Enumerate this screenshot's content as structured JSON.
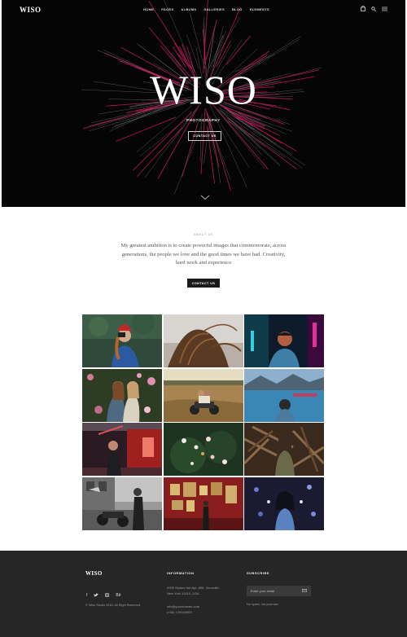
{
  "header": {
    "logo": "WISO",
    "menu": [
      "HOME",
      "PAGES",
      "ALBUMS",
      "GALLERIES",
      "BLOG",
      "ELEMENTS"
    ],
    "icons": [
      "bag-icon",
      "search-icon",
      "menu-icon"
    ]
  },
  "hero": {
    "title": "WISO",
    "subtitle": "PHOTOGRAPHY",
    "button_label": "CONTACT US"
  },
  "about": {
    "label": "ABOUT US",
    "text": "My greatest ambition is to create powerful images that commemorate, across generations, the people we love and the good times we have had. Creativity, hard work and experience",
    "button_label": "CONTACT US"
  },
  "gallery": {
    "tiles": [
      "woman-camera-red-beanie",
      "hair-closeup",
      "man-neon-lights",
      "women-flowers",
      "couple-motorcycle-field",
      "lake-mountains",
      "woman-red-neon-door",
      "flowers-dark",
      "woman-wood-pile",
      "motorcycle-street-bw",
      "red-gallery-room",
      "woman-blue-flowers"
    ]
  },
  "footer": {
    "logo": "WISO",
    "social": [
      "facebook-icon",
      "twitter-icon",
      "instagram-icon",
      "behance-icon"
    ],
    "copyright": "© Wiso Studio 2018. All Right Reserved.",
    "information_heading": "INFORMATION",
    "address_line1": "2005 Stokes Isle Apt. 896, Venaville,",
    "address_line2": "New York 10010, USA",
    "email": "info@yourdomain.com",
    "phone": "(+68) 120034509",
    "subscribe_heading": "SUBSCRIBE",
    "email_placeholder": "Enter your email",
    "no_spam": "No spam, we promise"
  },
  "colors": {
    "hero_bg": "#050505",
    "footer_bg": "#262626",
    "accent_lines": "#c2185b"
  }
}
